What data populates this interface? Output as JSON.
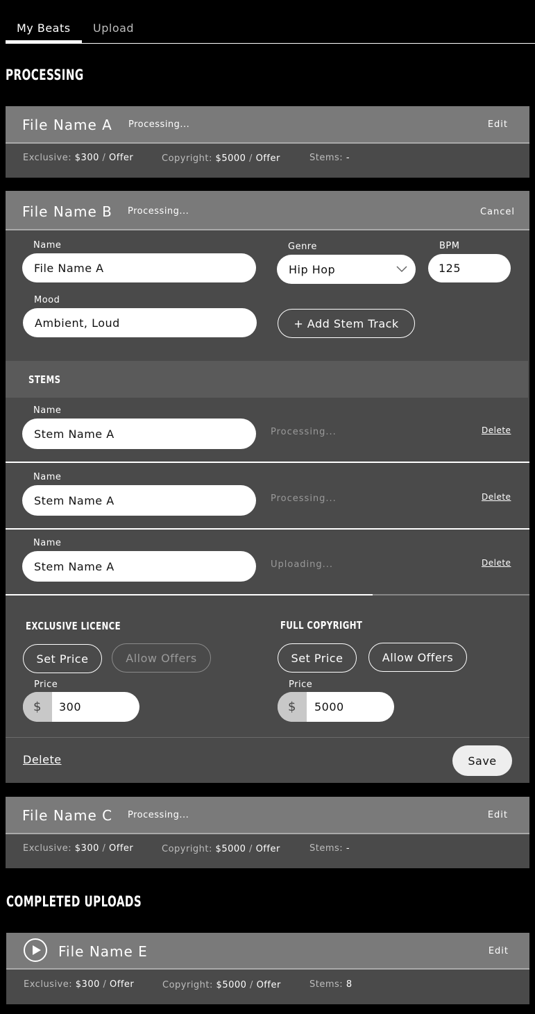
{
  "tabs": [
    {
      "label": "My Beats",
      "active": true
    },
    {
      "label": "Upload",
      "active": false
    }
  ],
  "sections": {
    "processing": "PROCESSING",
    "completed": "COMPLETED UPLOADS"
  },
  "labels": {
    "exclusive": "Exclusive:",
    "copyright": "Copyright:",
    "stems": "Stems:",
    "offer_sep": "/",
    "offer": "Offer"
  },
  "cards": {
    "a": {
      "name": "File Name A",
      "status": "Processing...",
      "action": "Edit",
      "exclusive_price": "$300",
      "copyright_price": "$5000",
      "stems": "-"
    },
    "b": {
      "name": "File Name B",
      "status": "Processing...",
      "action": "Cancel"
    },
    "c": {
      "name": "File Name C",
      "status": "Processing...",
      "action": "Edit",
      "exclusive_price": "$300",
      "copyright_price": "$5000",
      "stems": "-"
    },
    "e": {
      "name": "File Name E",
      "action": "Edit",
      "exclusive_price": "$300",
      "copyright_price": "$5000",
      "stems": "8"
    }
  },
  "form": {
    "name_label": "Name",
    "name_value": "File Name A",
    "genre_label": "Genre",
    "genre_value": "Hip Hop",
    "bpm_label": "BPM",
    "bpm_value": "125",
    "mood_label": "Mood",
    "mood_value": "Ambient, Loud",
    "add_stem": "+ Add Stem Track"
  },
  "stems": {
    "title": "STEMS",
    "delete": "Delete",
    "items": [
      {
        "label": "Name",
        "value": "Stem Name A",
        "status": "Processing..."
      },
      {
        "label": "Name",
        "value": "Stem Name A",
        "status": "Processing..."
      },
      {
        "label": "Name",
        "value": "Stem Name A",
        "status": "Uploading...",
        "upload_progress": 0.7
      }
    ]
  },
  "licence": {
    "exclusive_title": "EXCLUSIVE LICENCE",
    "copyright_title": "FULL COPYRIGHT",
    "set_price": "Set Price",
    "allow_offers": "Allow Offers",
    "price_label": "Price",
    "currency": "$",
    "exclusive_price": "300",
    "copyright_price": "5000"
  },
  "footer": {
    "delete": "Delete",
    "save": "Save"
  },
  "colors": {
    "background": "#000000",
    "card_header": "#7a7a7a",
    "card_body": "#4a4a4a"
  }
}
